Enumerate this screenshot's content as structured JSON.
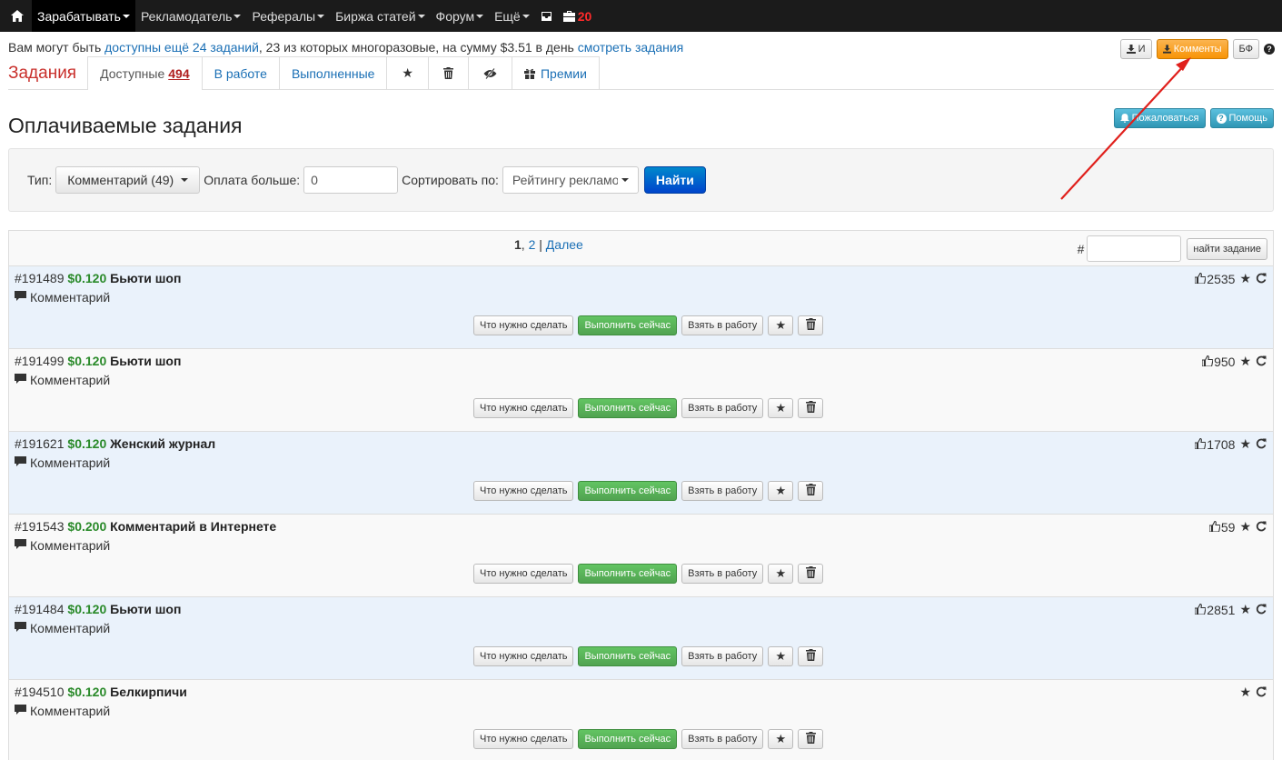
{
  "navbar": {
    "items": [
      {
        "label": "Зарабатывать",
        "caret": true,
        "active": true
      },
      {
        "label": "Рекламодатель",
        "caret": true
      },
      {
        "label": "Рефералы",
        "caret": true
      },
      {
        "label": "Биржа статей",
        "caret": true
      },
      {
        "label": "Форум",
        "caret": true
      },
      {
        "label": "Ещё",
        "caret": true
      }
    ],
    "count": "20"
  },
  "info": {
    "prefix": "Вам могут быть ",
    "link1": "доступны ещё 24 заданий",
    "middle": ", 23 из которых многоразовые, на сумму $3.51 в день ",
    "link2": "смотреть задания"
  },
  "top_buttons": {
    "import_label": "И",
    "comments_label": "Комменты",
    "bf_label": "БФ",
    "help_q": "?"
  },
  "tabs": {
    "title": "Задания",
    "available_label": "Доступные",
    "available_count": "494",
    "in_work": "В работе",
    "done": "Выполненные",
    "prizes": "Премии"
  },
  "heading": {
    "title": "Оплачиваемые задания",
    "complain": "Пожаловаться",
    "help": "Помощь"
  },
  "filter": {
    "type_label": "Тип:",
    "type_value": "Комментарий (49)",
    "pay_label": "Оплата больше:",
    "pay_value": "0",
    "sort_label": "Сортировать по:",
    "sort_value": "Рейтингу рекламодателя",
    "submit": "Найти"
  },
  "pager": {
    "current": "1",
    "sep": ", ",
    "page2": "2",
    "bar": " | ",
    "next": "Далее",
    "hash": "#",
    "find_btn": "найти задание"
  },
  "action_labels": {
    "what_to_do": "Что нужно сделать",
    "do_now": "Выполнить сейчас",
    "take": "Взять в работу"
  },
  "tasks": [
    {
      "id": "#191489",
      "price": "$0.120",
      "name": "Бьюти шоп",
      "type": "Комментарий",
      "likes": "2535"
    },
    {
      "id": "#191499",
      "price": "$0.120",
      "name": "Бьюти шоп",
      "type": "Комментарий",
      "likes": "950"
    },
    {
      "id": "#191621",
      "price": "$0.120",
      "name": "Женский журнал",
      "type": "Комментарий",
      "likes": "1708"
    },
    {
      "id": "#191543",
      "price": "$0.200",
      "name": "Комментарий в Интернете",
      "type": "Комментарий",
      "likes": "59"
    },
    {
      "id": "#191484",
      "price": "$0.120",
      "name": "Бьюти шоп",
      "type": "Комментарий",
      "likes": "2851"
    },
    {
      "id": "#194510",
      "price": "$0.120",
      "name": "Белкирпичи",
      "type": "Комментарий",
      "likes": ""
    }
  ],
  "colors": {
    "navbar": "#1b1b1b",
    "orange_button": "#f89406",
    "price_green": "#2a8a2a",
    "annotation_arrow": "#e0201c"
  }
}
